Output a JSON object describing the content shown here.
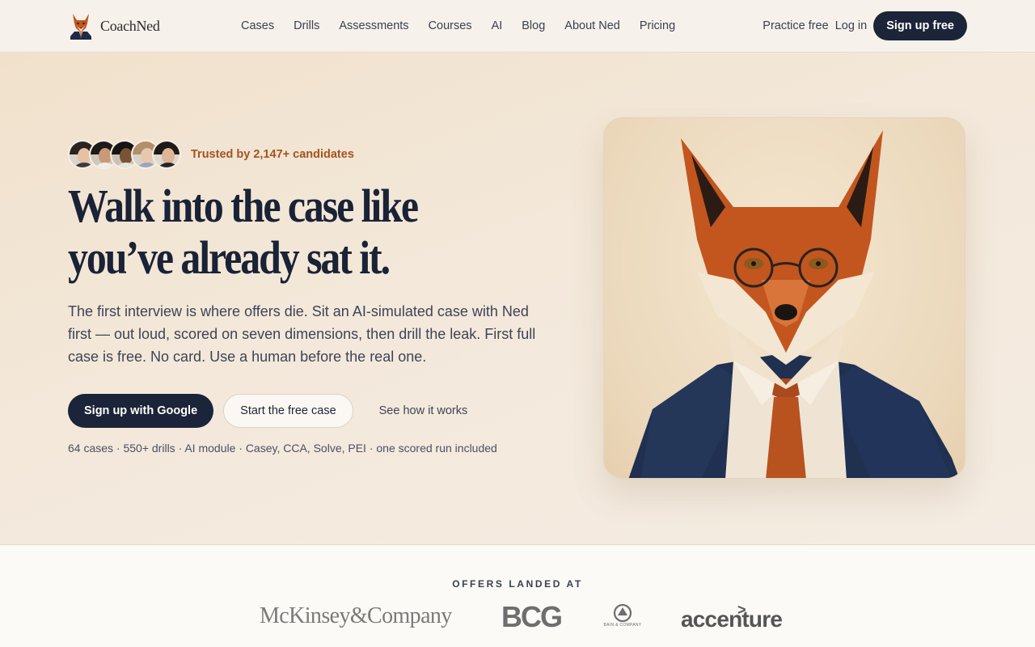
{
  "brand": {
    "name": "CoachNed"
  },
  "nav": {
    "links": [
      "Cases",
      "Drills",
      "Assessments",
      "Courses",
      "AI",
      "Blog",
      "About Ned",
      "Pricing"
    ],
    "practice": "Practice free",
    "login": "Log in",
    "signup": "Sign up free"
  },
  "hero": {
    "trusted": "Trusted by 2,147+ candidates",
    "headline": "Walk into the case like you’ve already sat it.",
    "subcopy": "The first interview is where offers die. Sit an AI-simulated case with Ned first — out loud, scored on seven dimensions, then drill the leak. First full case is free. No card. Use a human before the real one.",
    "cta_google": "Sign up with Google",
    "cta_free": "Start the free case",
    "cta_how": "See how it works",
    "meta": "64 cases · 550+ drills · AI module · Casey, CCA, Solve, PEI · one scored run included"
  },
  "logos": {
    "label": "OFFERS LANDED AT",
    "mckinsey": "McKinsey&Company",
    "bcg": "BCG",
    "bain": "BAIN & COMPANY",
    "accenture": "accenture"
  },
  "colors": {
    "navy": "#1b2438",
    "accent_rust": "#a3541f",
    "fox_orange": "#c2561e"
  },
  "icons": {
    "logo": "fox-head-icon",
    "hero_image": "fox-in-suit-illustration"
  }
}
